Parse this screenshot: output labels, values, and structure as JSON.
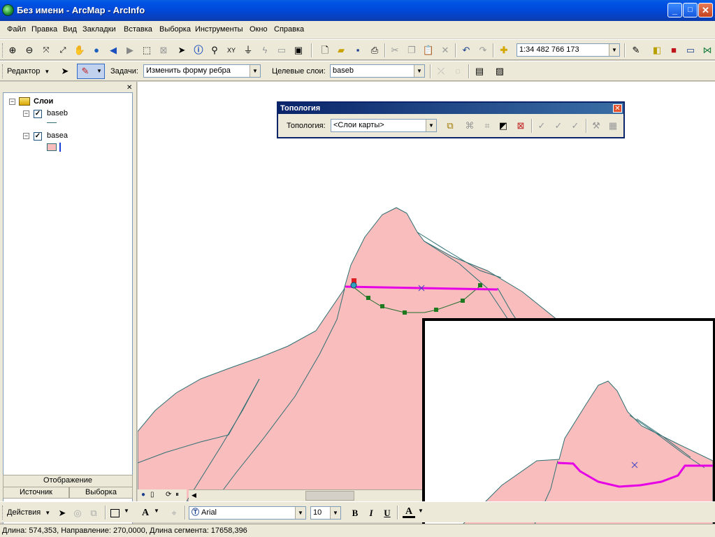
{
  "window": {
    "title": "Без имени - ArcMap - ArcInfo",
    "controls": {
      "minimize": "_",
      "maximize": "□",
      "close": "✕"
    }
  },
  "menu": [
    "Файл",
    "Правка",
    "Вид",
    "Закладки",
    "Вставка",
    "Выборка",
    "Инструменты",
    "Окно",
    "Справка"
  ],
  "standard_toolbar": {
    "scale": "1:34 482 766 173"
  },
  "editor_toolbar": {
    "editor_label": "Редактор",
    "task_label": "Задачи:",
    "task_value": "Изменить форму ребра",
    "target_label": "Целевые слои:",
    "target_value": "baseb"
  },
  "toc": {
    "root_label": "Слои",
    "layers": [
      {
        "name": "baseb",
        "checked": true
      },
      {
        "name": "basea",
        "checked": true
      }
    ],
    "tabs": {
      "display": "Отображение",
      "source": "Источник",
      "selection": "Выборка"
    }
  },
  "topology_window": {
    "title": "Топология",
    "label": "Топология:",
    "value": "<Слои карты>"
  },
  "drawing_toolbar": {
    "actions_label": "Действия",
    "font": "Arial",
    "size": "10",
    "bold": "B",
    "italic": "I",
    "underline": "U",
    "font_color": "A"
  },
  "status": {
    "text": "Длина: 574,353, Направление: 270,0000, Длина сегмента: 17658,396"
  },
  "colors": {
    "polygon_fill": "#f9bdbd",
    "edge_line": "#2f6f73",
    "selected_edge": "#e600e6",
    "vertex": "#1f7a1f",
    "sketch_line": "#1f6f2a",
    "title_bar": "#0055e5"
  }
}
